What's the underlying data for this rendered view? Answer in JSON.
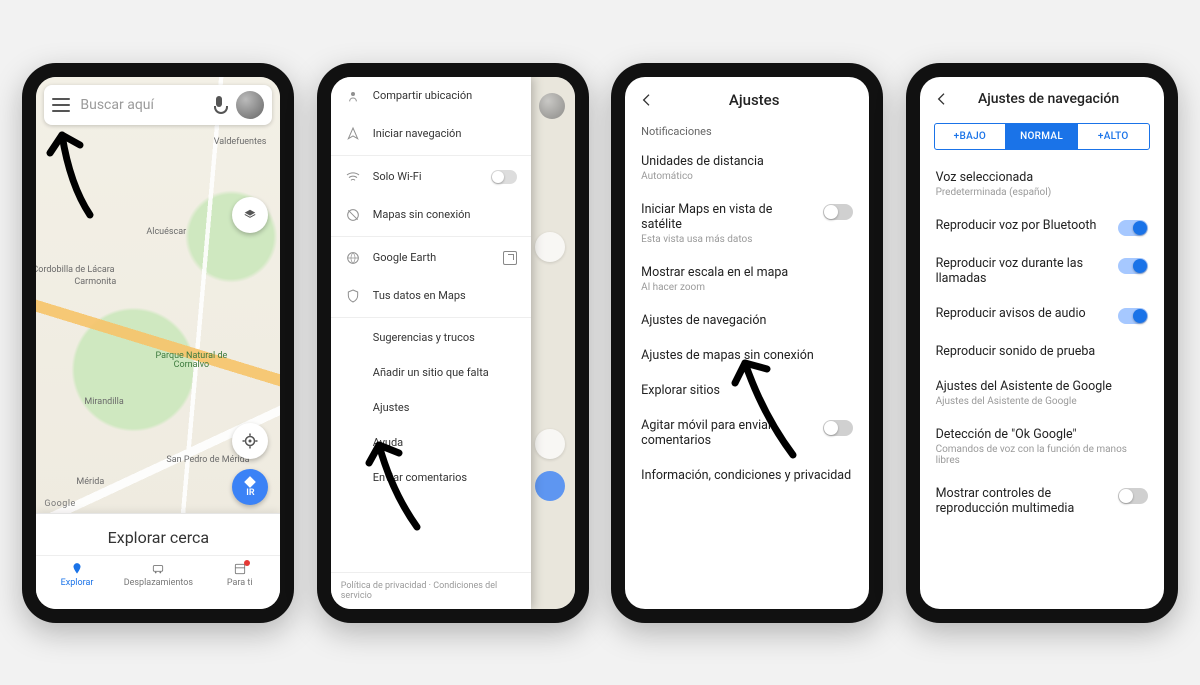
{
  "phone1": {
    "search_placeholder": "Buscar aquí",
    "explore_title": "Explorar cerca",
    "go_label": "IR",
    "tabs": [
      {
        "label": "Explorar",
        "active": true
      },
      {
        "label": "Desplazamientos",
        "active": false
      },
      {
        "label": "Para ti",
        "active": false,
        "badge": true
      }
    ],
    "map_labels": {
      "valdefuentes": "Valdefuentes",
      "alcuescar": "Alcuéscar",
      "carmonita": "Carmonita",
      "cordobilla": "Cordobilla de Lácara",
      "mirandilla": "Mirandilla",
      "merida": "Mérida",
      "sanpedro": "San Pedro de Mérida",
      "park": "Parque Natural de Cornalvo"
    },
    "google": "Google"
  },
  "phone2": {
    "items": [
      {
        "icon": "share-location-icon",
        "label": "Compartir ubicación"
      },
      {
        "icon": "navigate-icon",
        "label": "Iniciar navegación"
      },
      {
        "icon": "wifi-icon",
        "label": "Solo Wi-Fi",
        "toggle": false
      },
      {
        "icon": "offline-icon",
        "label": "Mapas sin conexión"
      },
      {
        "icon": "earth-icon",
        "label": "Google Earth",
        "external": true
      },
      {
        "icon": "privacy-icon",
        "label": "Tus datos en Maps"
      }
    ],
    "plain": [
      "Sugerencias y trucos",
      "Añadir un sitio que falta",
      "Ajustes",
      "Ayuda",
      "Enviar comentarios"
    ],
    "footer": "Política de privacidad  ·  Condiciones del servicio"
  },
  "phone3": {
    "title": "Ajustes",
    "section": "Notificaciones",
    "rows": [
      {
        "title": "Unidades de distancia",
        "sub": "Automático"
      },
      {
        "title": "Iniciar Maps en vista de satélite",
        "sub": "Esta vista usa más datos",
        "switch": false
      },
      {
        "title": "Mostrar escala en el mapa",
        "sub": "Al hacer zoom"
      },
      {
        "title": "Ajustes de navegación"
      },
      {
        "title": "Ajustes de mapas sin conexión"
      },
      {
        "title": "Explorar sitios"
      },
      {
        "title": "Agitar móvil para enviar comentarios",
        "switch": false
      },
      {
        "title": "Información, condiciones y privacidad"
      }
    ]
  },
  "phone4": {
    "title": "Ajustes de navegación",
    "vol": {
      "low": "+BAJO",
      "normal": "NORMAL",
      "high": "+ALTO"
    },
    "voice_label": "Voz seleccionada",
    "voice_value": "Predeterminada (español)",
    "rows": [
      {
        "title": "Reproducir voz por Bluetooth",
        "switch": true
      },
      {
        "title": "Reproducir voz durante las llamadas",
        "switch": true
      },
      {
        "title": "Reproducir avisos de audio",
        "switch": true
      },
      {
        "title": "Reproducir sonido de prueba"
      },
      {
        "title": "Ajustes del Asistente de Google",
        "sub": "Ajustes del Asistente de Google"
      },
      {
        "title": "Detección de \"Ok Google\"",
        "sub": "Comandos de voz con la función de manos libres"
      },
      {
        "title": "Mostrar controles de reproducción multimedia",
        "switch": false
      }
    ]
  }
}
